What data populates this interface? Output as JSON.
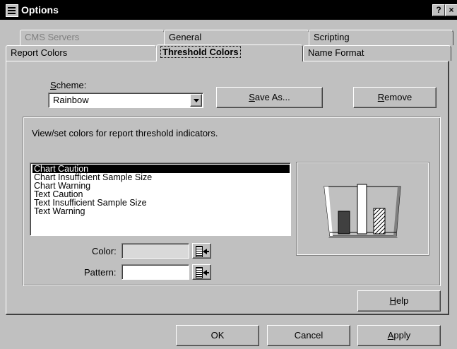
{
  "window": {
    "title": "Options",
    "help_glyph": "?",
    "close_glyph": "×"
  },
  "tabs": {
    "row_back": [
      "CMS Servers",
      "General",
      "Scripting"
    ],
    "row_front": [
      "Report Colors",
      "Threshold Colors",
      "Name Format"
    ],
    "active": "Threshold Colors",
    "disabled": "CMS Servers"
  },
  "scheme": {
    "label_mnemonic": "S",
    "label_rest": "cheme:",
    "value": "Rainbow"
  },
  "buttons": {
    "save_as_mn": "S",
    "save_as_rest": "ave As...",
    "remove_mn": "R",
    "remove_rest": "emove",
    "help_mn": "H",
    "help_rest": "elp",
    "ok": "OK",
    "cancel": "Cancel",
    "apply_mn": "A",
    "apply_rest": "pply"
  },
  "group": {
    "description": "View/set colors for report threshold indicators.",
    "items": [
      "Chart Caution",
      "Chart Insufficient Sample Size",
      "Chart Warning",
      "Text Caution",
      "Text Insufficient Sample Size",
      "Text Warning"
    ],
    "selected_index": 0
  },
  "fields": {
    "color_label": "Color:",
    "pattern_label": "Pattern:"
  },
  "icons": {
    "app": "options-window-icon",
    "picker": "color-picker-icon",
    "dropdown": "chevron-down-icon"
  }
}
